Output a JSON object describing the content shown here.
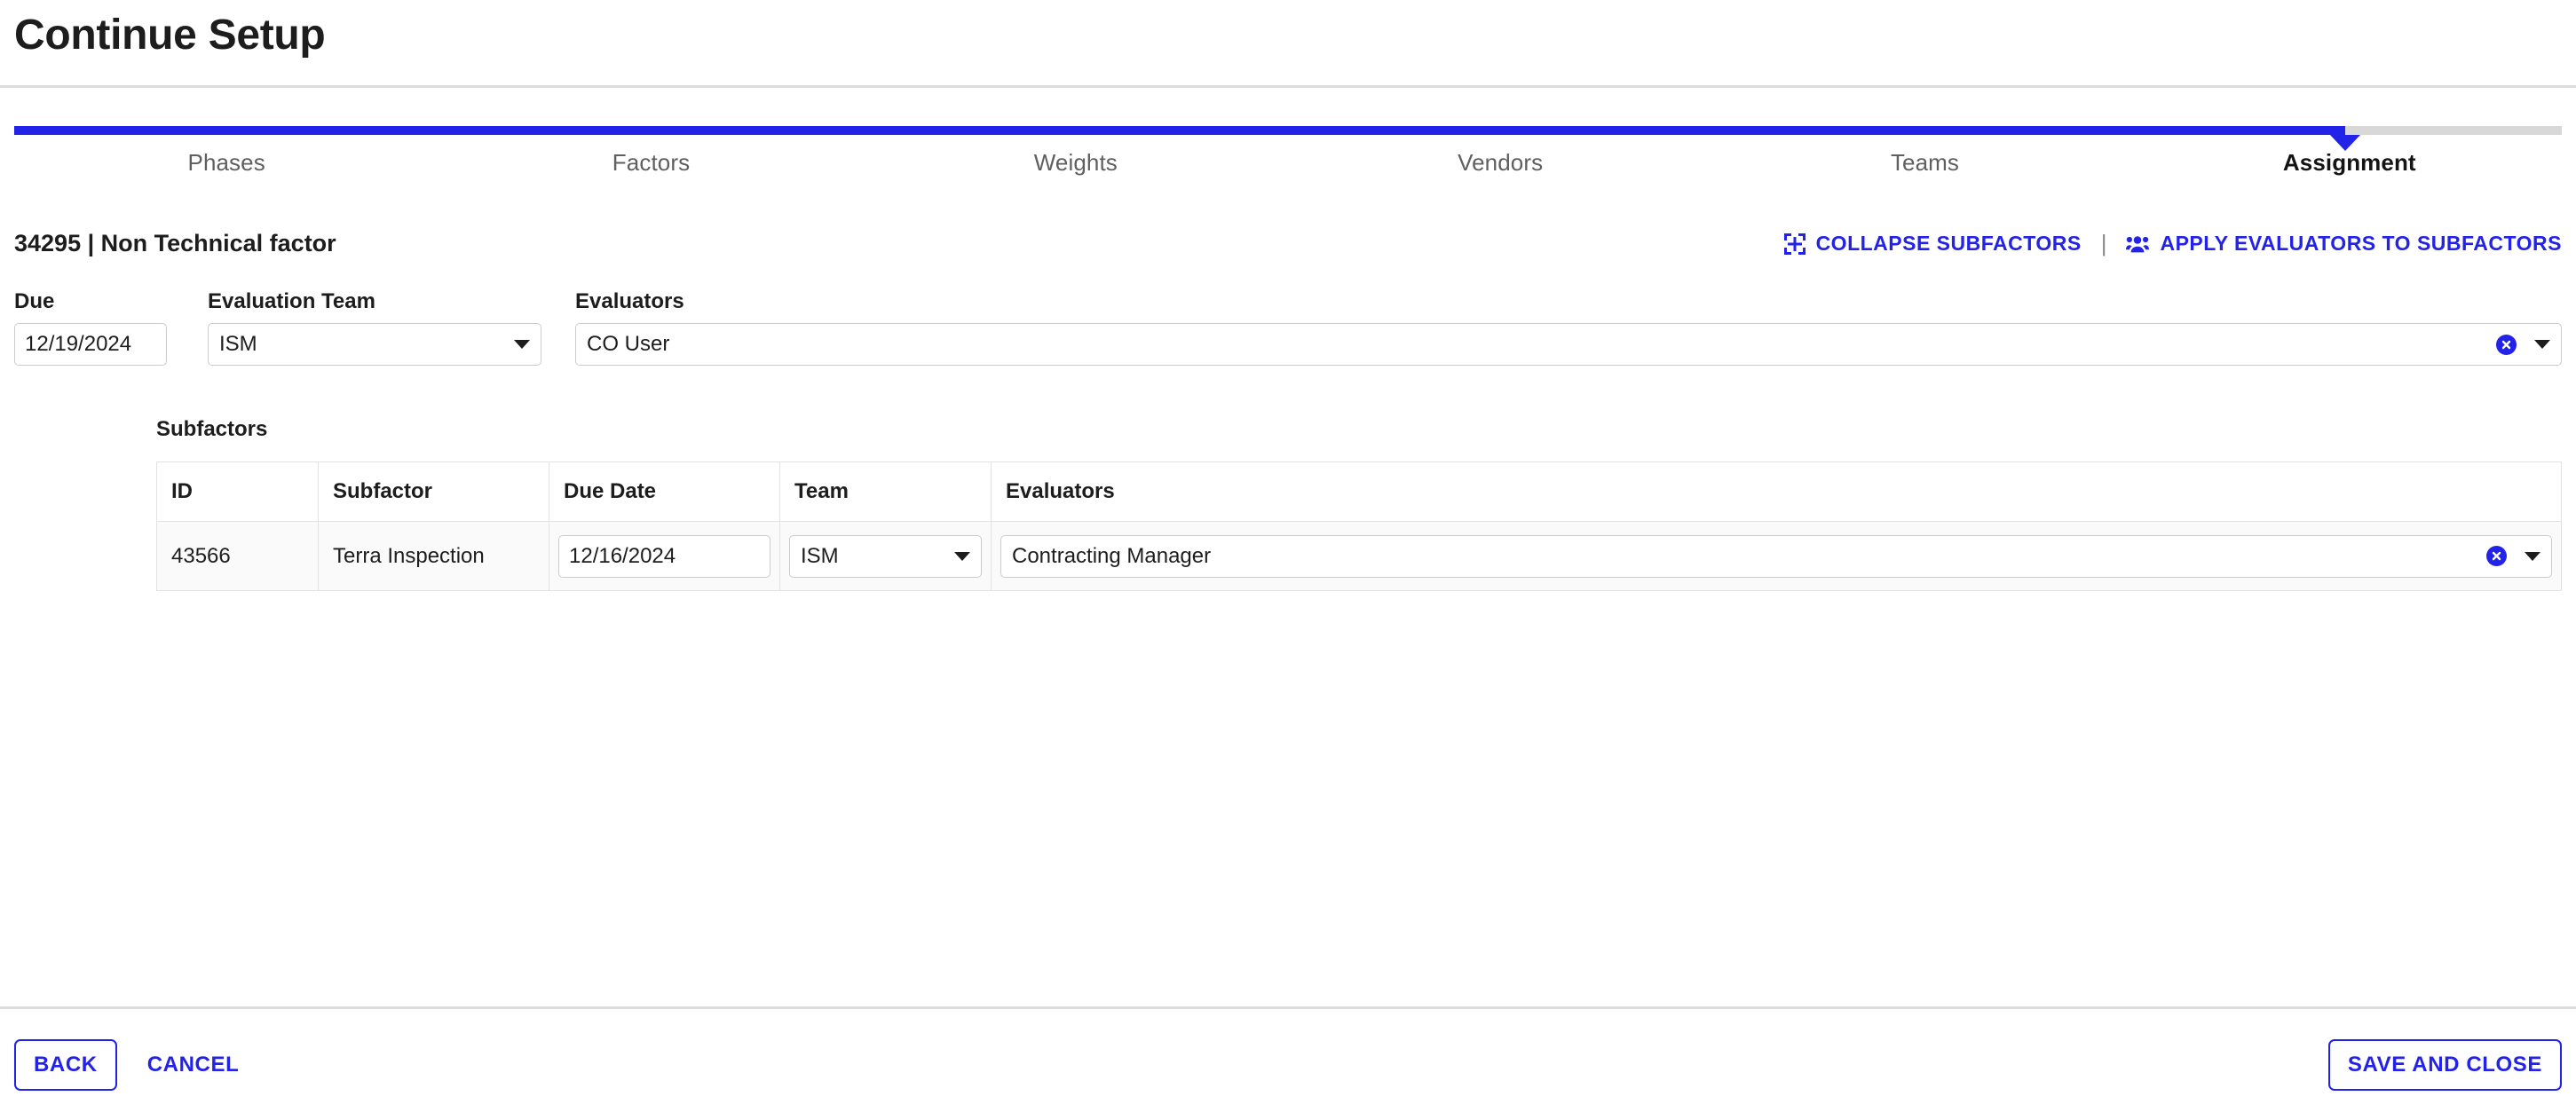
{
  "header": {
    "title": "Continue Setup"
  },
  "stepper": {
    "accent_color": "#2222e8",
    "track_color": "#d8d8d8",
    "fill_percent": 91.5,
    "active_index": 5,
    "steps": [
      {
        "label": "Phases"
      },
      {
        "label": "Factors"
      },
      {
        "label": "Weights"
      },
      {
        "label": "Vendors"
      },
      {
        "label": "Teams"
      },
      {
        "label": "Assignment"
      }
    ]
  },
  "factor": {
    "title": "34295 | Non Technical factor",
    "actions": {
      "collapse_label": "COLLAPSE SUBFACTORS",
      "collapse_icon": "collapse-icon",
      "separator": "|",
      "apply_label": "APPLY EVALUATORS TO SUBFACTORS",
      "apply_icon": "people-group-icon",
      "link_color": "#2222e8"
    }
  },
  "form": {
    "due": {
      "label": "Due",
      "value": "12/19/2024",
      "placeholder": "mm/dd/yyyy",
      "calendar_icon": "calendar-icon"
    },
    "evaluation_team": {
      "label": "Evaluation Team",
      "value": "ISM",
      "options": [
        "ISM"
      ]
    },
    "evaluators": {
      "label": "Evaluators",
      "value": "CO User",
      "clear_icon": "clear-circle-icon",
      "options": [
        "CO User"
      ]
    }
  },
  "subfactors": {
    "title": "Subfactors",
    "columns": [
      "ID",
      "Subfactor",
      "Due Date",
      "Team",
      "Evaluators"
    ],
    "rows": [
      {
        "id": "43566",
        "subfactor": "Terra Inspection",
        "due_date": "12/16/2024",
        "due_date_icon": "calendar-icon",
        "team": "ISM",
        "evaluators": "Contracting Manager",
        "evaluators_clear_icon": "clear-circle-icon"
      }
    ]
  },
  "footer": {
    "back_label": "BACK",
    "cancel_label": "CANCEL",
    "save_label": "SAVE AND CLOSE",
    "button_color": "#2222e8"
  }
}
